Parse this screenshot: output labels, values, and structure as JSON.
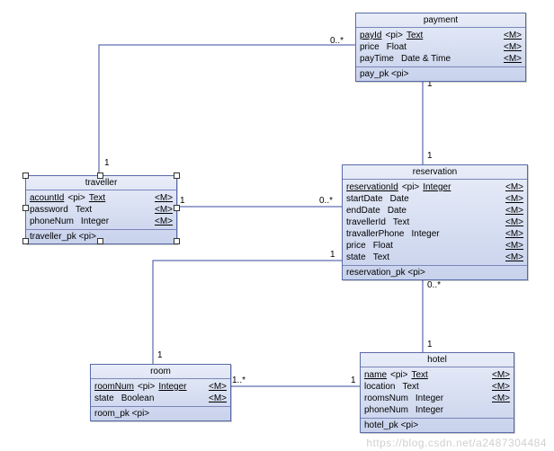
{
  "entities": {
    "payment": {
      "title": "payment",
      "attrs": [
        {
          "name": "payId",
          "pi": "<pi>",
          "type": "Text",
          "m": "<M>",
          "u": true
        },
        {
          "name": "price",
          "pi": "",
          "type": "Float",
          "m": "<M>",
          "u": false
        },
        {
          "name": "payTime",
          "pi": "",
          "type": "Date & Time",
          "m": "<M>",
          "u": false
        }
      ],
      "pk": "pay_pk  <pi>"
    },
    "reservation": {
      "title": "reservation",
      "attrs": [
        {
          "name": "reservationId",
          "pi": "<pi>",
          "type": "Integer",
          "m": "<M>",
          "u": true
        },
        {
          "name": "startDate",
          "pi": "",
          "type": "Date",
          "m": "<M>",
          "u": false
        },
        {
          "name": "endDate",
          "pi": "",
          "type": "Date",
          "m": "<M>",
          "u": false
        },
        {
          "name": "travellerId",
          "pi": "",
          "type": "Text",
          "m": "<M>",
          "u": false
        },
        {
          "name": "travallerPhone",
          "pi": "",
          "type": "Integer",
          "m": "<M>",
          "u": false
        },
        {
          "name": "price",
          "pi": "",
          "type": "Float",
          "m": "<M>",
          "u": false
        },
        {
          "name": "state",
          "pi": "",
          "type": "Text",
          "m": "<M>",
          "u": false
        }
      ],
      "pk": "reservation_pk  <pi>"
    },
    "traveller": {
      "title": "traveller",
      "attrs": [
        {
          "name": "acountId",
          "pi": "<pi>",
          "type": "Text",
          "m": "<M>",
          "u": true
        },
        {
          "name": "password",
          "pi": "",
          "type": "Text",
          "m": "<M>",
          "u": false
        },
        {
          "name": "phoneNum",
          "pi": "",
          "type": "Integer",
          "m": "<M>",
          "u": false
        }
      ],
      "pk": "traveller_pk  <pi>"
    },
    "room": {
      "title": "room",
      "attrs": [
        {
          "name": "roomNum",
          "pi": "<pi>",
          "type": "Integer",
          "m": "<M>",
          "u": true
        },
        {
          "name": "state",
          "pi": "",
          "type": "Boolean",
          "m": "<M>",
          "u": false
        }
      ],
      "pk": "room_pk  <pi>"
    },
    "hotel": {
      "title": "hotel",
      "attrs": [
        {
          "name": "name",
          "pi": "<pi>",
          "type": "Text",
          "m": "<M>",
          "u": true
        },
        {
          "name": "location",
          "pi": "",
          "type": "Text",
          "m": "<M>",
          "u": false
        },
        {
          "name": "roomsNum",
          "pi": "",
          "type": "Integer",
          "m": "<M>",
          "u": false
        },
        {
          "name": "phoneNum",
          "pi": "",
          "type": "Integer",
          "m": "",
          "u": false
        }
      ],
      "pk": "hotel_pk  <pi>"
    }
  },
  "mult": {
    "pay_left": "0..*",
    "pay_res_top": "1",
    "res_left": "0..*",
    "trav_right": "1",
    "trav_top": "1",
    "res_bot": "0..*",
    "hotel_top": "1",
    "room_right": "1..*",
    "hotel_left": "1",
    "res_room": "1"
  },
  "watermark": "https://blog.csdn.net/a2487304484"
}
